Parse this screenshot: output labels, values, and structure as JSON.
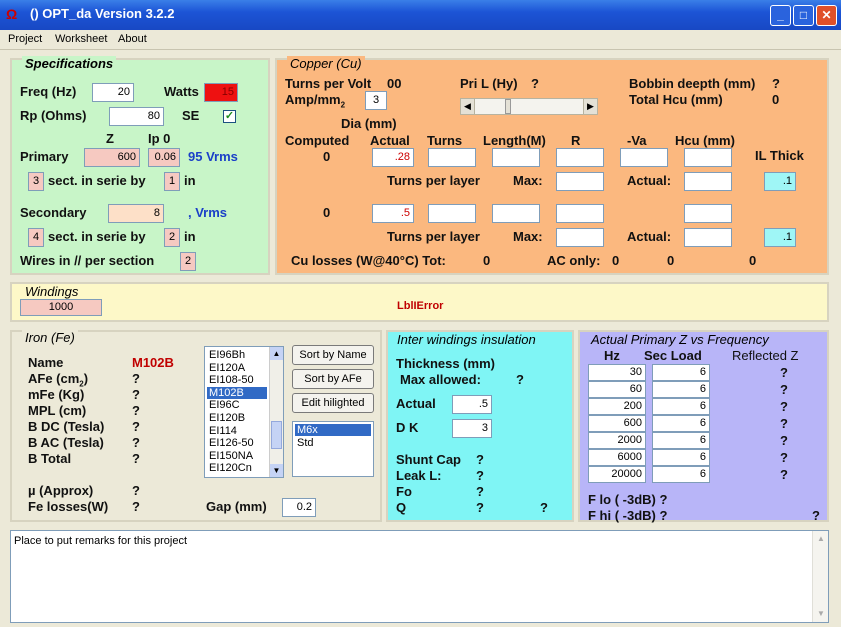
{
  "window": {
    "title": "()  OPT_da Version 3.2.2",
    "app_icon": "Ω"
  },
  "menu": [
    "Project",
    "Worksheet",
    "About"
  ],
  "spec": {
    "title": "Specifications",
    "freq_label": "Freq (Hz)",
    "freq": "20",
    "watts_label": "Watts",
    "watts": "15",
    "rp_label": "Rp (Ohms)",
    "rp": "80",
    "se_label": "SE",
    "se_checked": "✓",
    "z_label": "Z",
    "ip_label": "Ip 0",
    "primary_label": "Primary",
    "primary_z": "600",
    "primary_ip": "0.06",
    "primary_vrms": "95 Vrms",
    "sect1": "3",
    "sect_text": "sect. in serie by",
    "by1": "1",
    "in_text": "in",
    "secondary_label": "Secondary",
    "secondary_z": "8",
    "secondary_vrms": ", Vrms",
    "sect2": "4",
    "by2": "2",
    "wires_label": "Wires in // per section",
    "wires": "2"
  },
  "copper": {
    "title": "Copper (Cu)",
    "tpv_label": "Turns per Volt",
    "tpv": "00",
    "amp_label": "Amp/mm",
    "amp_sub": "2",
    "amp": "3",
    "pril_label": "Pri L (Hy)",
    "pril": "?",
    "bobbin_label": "Bobbin deepth (mm)",
    "bobbin": "?",
    "total_hcu_label": "Total Hcu (mm)",
    "total_hcu": "0",
    "dia_label": "Dia (mm)",
    "headers": [
      "Computed",
      "Actual",
      "Turns",
      "Length(M)",
      "R",
      "-Va",
      "Hcu (mm)",
      "IL Thick"
    ],
    "row1_computed": "0",
    "row1_actual": ".28",
    "row2_computed": "0",
    "row2_actual": ".5",
    "tpl_label": "Turns per layer",
    "max_label": "Max:",
    "actual_label": "Actual:",
    "il1": ".1",
    "il2": ".1",
    "losses_label": "Cu losses (W@40°C) Tot:",
    "losses_tot": "0",
    "ac_label": "AC only:",
    "ac1": "0",
    "ac2": "0",
    "ac3": "0"
  },
  "windings": {
    "title": "Windings",
    "value": "1000",
    "error": "LblIError"
  },
  "iron": {
    "title": "Iron (Fe)",
    "name_label": "Name",
    "name": "M102B",
    "rows": [
      {
        "label": "AFe (cm",
        "sub": "2",
        "close": ")",
        "val": "?"
      },
      {
        "label": "mFe (Kg)",
        "sub": "",
        "close": "",
        "val": "?"
      },
      {
        "label": "MPL (cm)",
        "sub": "",
        "close": "",
        "val": "?"
      },
      {
        "label": "B DC (Tesla)",
        "sub": "",
        "close": "",
        "val": "?"
      },
      {
        "label": "B AC (Tesla)",
        "sub": "",
        "close": "",
        "val": "?"
      },
      {
        "label": "B Total",
        "sub": "",
        "close": "",
        "val": "?"
      }
    ],
    "mu_label": "µ (Approx)",
    "mu": "?",
    "felosses_label": "Fe losses(W)",
    "felosses": "?",
    "gap_label": "Gap (mm)",
    "gap": "0.2",
    "list": [
      "EI96Bh",
      "EI120A",
      "EI108-50",
      "M102B",
      "EI96C",
      "EI120B",
      "EI114",
      "EI126-50",
      "EI150NA",
      "EI120Cn"
    ],
    "selected_index": 3,
    "sort_name": "Sort by Name",
    "sort_afe": "Sort by AFe",
    "edit": "Edit hilighted",
    "list2": [
      "M6x",
      "Std"
    ]
  },
  "insul": {
    "title": "Inter windings insulation",
    "thickness_label": "Thickness (mm)",
    "max_allowed_label": "Max allowed:",
    "max_allowed": "?",
    "actual_label": "Actual",
    "actual": ".5",
    "dk_label": "D K",
    "dk": "3",
    "shunt_label": "Shunt Cap",
    "shunt": "?",
    "leak_label": "Leak L:",
    "leak": "?",
    "fo_label": "Fo",
    "fo": "?",
    "q_label": "Q",
    "q": "?",
    "q2": "?"
  },
  "freq": {
    "title": "Actual Primary Z vs Frequency",
    "hz_label": "Hz",
    "load_label": "Sec Load",
    "refl_label": "Reflected Z",
    "rows": [
      {
        "hz": "30",
        "load": "6",
        "z": "?"
      },
      {
        "hz": "60",
        "load": "6",
        "z": "?"
      },
      {
        "hz": "200",
        "load": "6",
        "z": "?"
      },
      {
        "hz": "600",
        "load": "6",
        "z": "?"
      },
      {
        "hz": "2000",
        "load": "6",
        "z": "?"
      },
      {
        "hz": "6000",
        "load": "6",
        "z": "?"
      },
      {
        "hz": "20000",
        "load": "6",
        "z": "?"
      }
    ],
    "flo_label": "F lo ( -3dB)",
    "flo": "?",
    "fhi_label": "F hi ( -3dB)",
    "fhi": "?",
    "fhi2": "?"
  },
  "remarks": {
    "text": "Place to put remarks for this project"
  },
  "colors": {
    "spec_bg": "#c8f5c8",
    "copper_bg": "#fbb87f",
    "windings_bg": "#fdf8c8",
    "iron_bg": "#ece9d8",
    "insul_bg": "#7ff5f5",
    "freq_bg": "#b8b5f8"
  }
}
